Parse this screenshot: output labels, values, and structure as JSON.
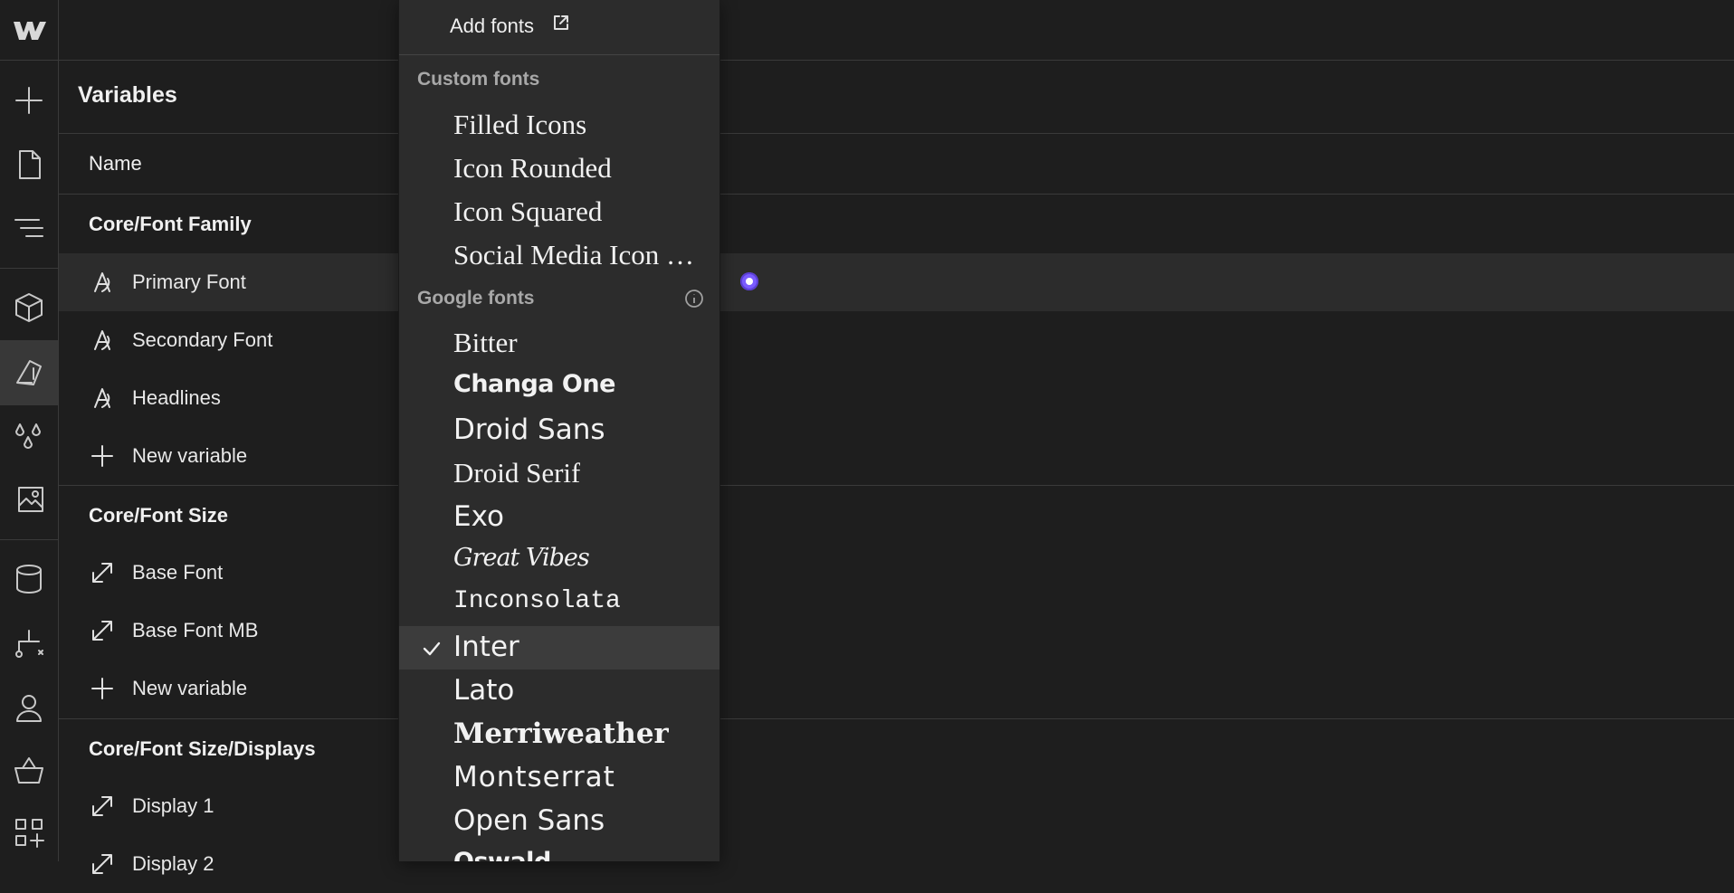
{
  "panel": {
    "title": "Variables",
    "column_name": "Name",
    "groups": [
      {
        "title": "Core/Font Family",
        "items": [
          {
            "label": "Primary Font",
            "icon": "font-icon"
          },
          {
            "label": "Secondary Font",
            "icon": "font-icon"
          },
          {
            "label": "Headlines",
            "icon": "font-icon"
          },
          {
            "label": "New variable",
            "icon": "plus-icon"
          }
        ]
      },
      {
        "title": "Core/Font Size",
        "items": [
          {
            "label": "Base Font",
            "icon": "resize-icon"
          },
          {
            "label": "Base Font MB",
            "icon": "resize-icon"
          },
          {
            "label": "New variable",
            "icon": "plus-icon"
          }
        ]
      },
      {
        "title": "Core/Font Size/Displays",
        "items": [
          {
            "label": "Display 1",
            "icon": "resize-icon"
          },
          {
            "label": "Display 2",
            "icon": "resize-icon"
          }
        ]
      }
    ]
  },
  "dropdown": {
    "add_fonts": "Add fonts",
    "custom_section": "Custom fonts",
    "custom_fonts": [
      "Filled Icons",
      "Icon Rounded",
      "Icon Squared",
      "Social Media Icon Font"
    ],
    "google_section": "Google fonts",
    "google_fonts": [
      "Bitter",
      "Changa One",
      "Droid Sans",
      "Droid Serif",
      "Exo",
      "Great Vibes",
      "Inconsolata",
      "Inter",
      "Lato",
      "Merriweather",
      "Montserrat",
      "Open Sans",
      "Oswald"
    ],
    "selected_font": "Inter"
  },
  "colors": {
    "background": "#1e1e1e",
    "dropdown": "#2c2c2c",
    "accent": "#7a5cff"
  }
}
